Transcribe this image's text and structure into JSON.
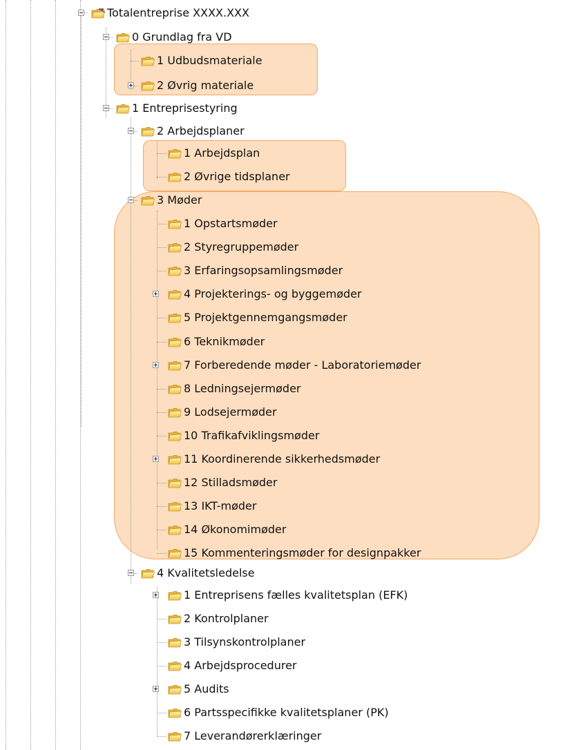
{
  "tree": {
    "root": "Totalentreprise XXXX.XXX",
    "grundlag": "0 Grundlag fra VD",
    "udbud": "1 Udbudsmateriale",
    "ovrig_materiale": "2 Øvrig materiale",
    "entreprisestyring": "1 Entreprisestyring",
    "arbejdsplaner": "2 Arbejdsplaner",
    "arbejdsplan": "1 Arbejdsplan",
    "ovrige_tidsplaner": "2 Øvrige tidsplaner",
    "moder": "3 Møder",
    "moder_items": [
      "1 Opstartsmøder",
      "2 Styregruppemøder",
      "3 Erfaringsopsamlingsmøder",
      "4 Projekterings- og byggemøder",
      "5 Projektgennemgangsmøder",
      "6 Teknikmøder",
      "7 Forberedende møder - Laboratoriemøder",
      "8 Ledningsejermøder",
      "9 Lodsejermøder",
      "10 Trafikafviklingsmøder",
      "11 Koordinerende sikkerhedsmøder",
      "12 Stilladsmøder",
      "13 IKT-møder",
      "14 Økonomimøder",
      "15 Kommenteringsmøder for designpakker"
    ],
    "kvalitet": "4 Kvalitetsledelse",
    "kvalitet_items": [
      "1 Entreprisens fælles kvalitetsplan (EFK)",
      "2 Kontrolplaner",
      "3 Tilsynskontrolplaner",
      "4 Arbejdsprocedurer",
      "5 Audits",
      "6 Partsspecifikke kvalitetsplaner (PK)",
      "7 Leverandørerklæringer"
    ]
  },
  "icons": {
    "folder": "folder-icon",
    "root": "project-folder-icon",
    "expand": "expand-plus-icon",
    "collapse": "collapse-minus-icon"
  },
  "colors": {
    "highlight_fill": "#fccd9e",
    "highlight_border": "#f3a866",
    "folder_light": "#fff2a0",
    "folder_dark": "#e8b53a"
  }
}
